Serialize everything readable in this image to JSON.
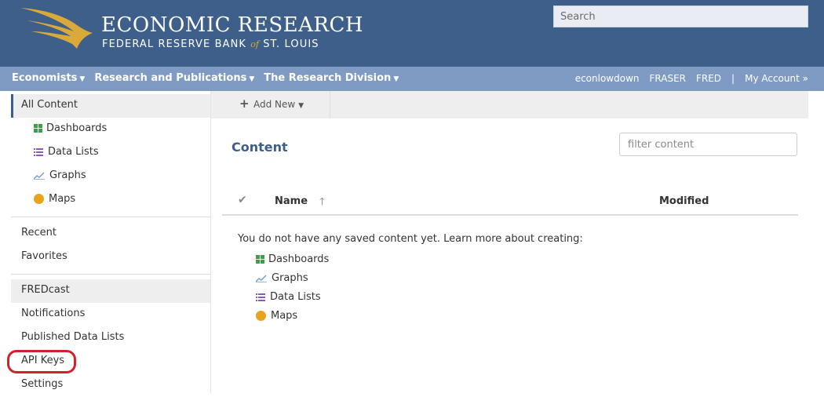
{
  "header": {
    "title": "ECONOMIC RESEARCH",
    "subtitle_pre": "FEDERAL RESERVE BANK ",
    "subtitle_of": "of",
    "subtitle_post": " ST. LOUIS",
    "search_placeholder": "Search"
  },
  "nav": {
    "left": [
      "Economists",
      "Research and Publications",
      "The Research Division"
    ],
    "right": [
      "econlowdown",
      "FRASER",
      "FRED",
      "|",
      "My Account"
    ]
  },
  "sidebar": {
    "all_content": "All Content",
    "content_types": [
      "Dashboards",
      "Data Lists",
      "Graphs",
      "Maps"
    ],
    "group2": [
      "Recent",
      "Favorites"
    ],
    "group3": [
      "FREDcast",
      "Notifications",
      "Published Data Lists",
      "API Keys",
      "Settings"
    ]
  },
  "toolbar": {
    "add_new": "Add New"
  },
  "main": {
    "title": "Content",
    "filter_placeholder": "filter content",
    "columns": {
      "name": "Name",
      "modified": "Modified"
    },
    "empty_message": "You do not have any saved content yet. Learn more about creating:",
    "learn_items": [
      "Dashboards",
      "Graphs",
      "Data Lists",
      "Maps"
    ]
  },
  "colors": {
    "header_bg": "#3e5f8a",
    "nav_bg": "#7f9bc4",
    "accent_gold": "#d9a93a",
    "highlight_red": "#d0212f"
  },
  "icons": [
    "eagle-logo-icon",
    "caret-down-icon",
    "plus-icon",
    "grid-icon",
    "list-icon",
    "chart-icon",
    "globe-icon",
    "check-icon",
    "sort-up-icon"
  ]
}
